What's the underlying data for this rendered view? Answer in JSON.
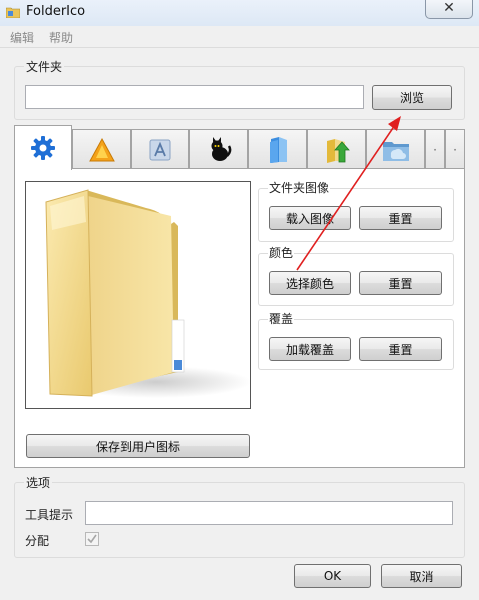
{
  "window": {
    "title": "FolderIco",
    "close_glyph": "✕"
  },
  "menu": {
    "items": [
      {
        "label": "编辑"
      },
      {
        "label": "帮助"
      }
    ]
  },
  "folder_group": {
    "label": "文件夹",
    "path_value": "",
    "browse_label": "浏览"
  },
  "tabs": [
    {
      "icon": "gear-icon",
      "active": true
    },
    {
      "icon": "warning-icon"
    },
    {
      "icon": "app-store-icon"
    },
    {
      "icon": "black-cat-icon"
    },
    {
      "icon": "blue-folder-icon"
    },
    {
      "icon": "green-arrow-folder-icon"
    },
    {
      "icon": "blue-folder-cloud-icon"
    }
  ],
  "tab_scroll": {
    "left": "·",
    "right": "·"
  },
  "image_group": {
    "label": "文件夹图像",
    "load_label": "载入图像",
    "reset_label": "重置"
  },
  "color_group": {
    "label": "颜色",
    "choose_label": "选择颜色",
    "reset_label": "重置"
  },
  "overlay_group": {
    "label": "覆盖",
    "load_label": "加载覆盖",
    "reset_label": "重置"
  },
  "save_user_icon_label": "保存到用户图标",
  "options_group": {
    "label": "选项",
    "tooltip_label": "工具提示",
    "tooltip_value": "",
    "assign_label": "分配",
    "assign_checked": true
  },
  "dialog_buttons": {
    "ok_label": "OK",
    "cancel_label": "取消"
  },
  "colors": {
    "annotation_arrow": "#e02020",
    "tab_gear": "#1f6fd6",
    "folder_yellow": "#f2d98a"
  }
}
